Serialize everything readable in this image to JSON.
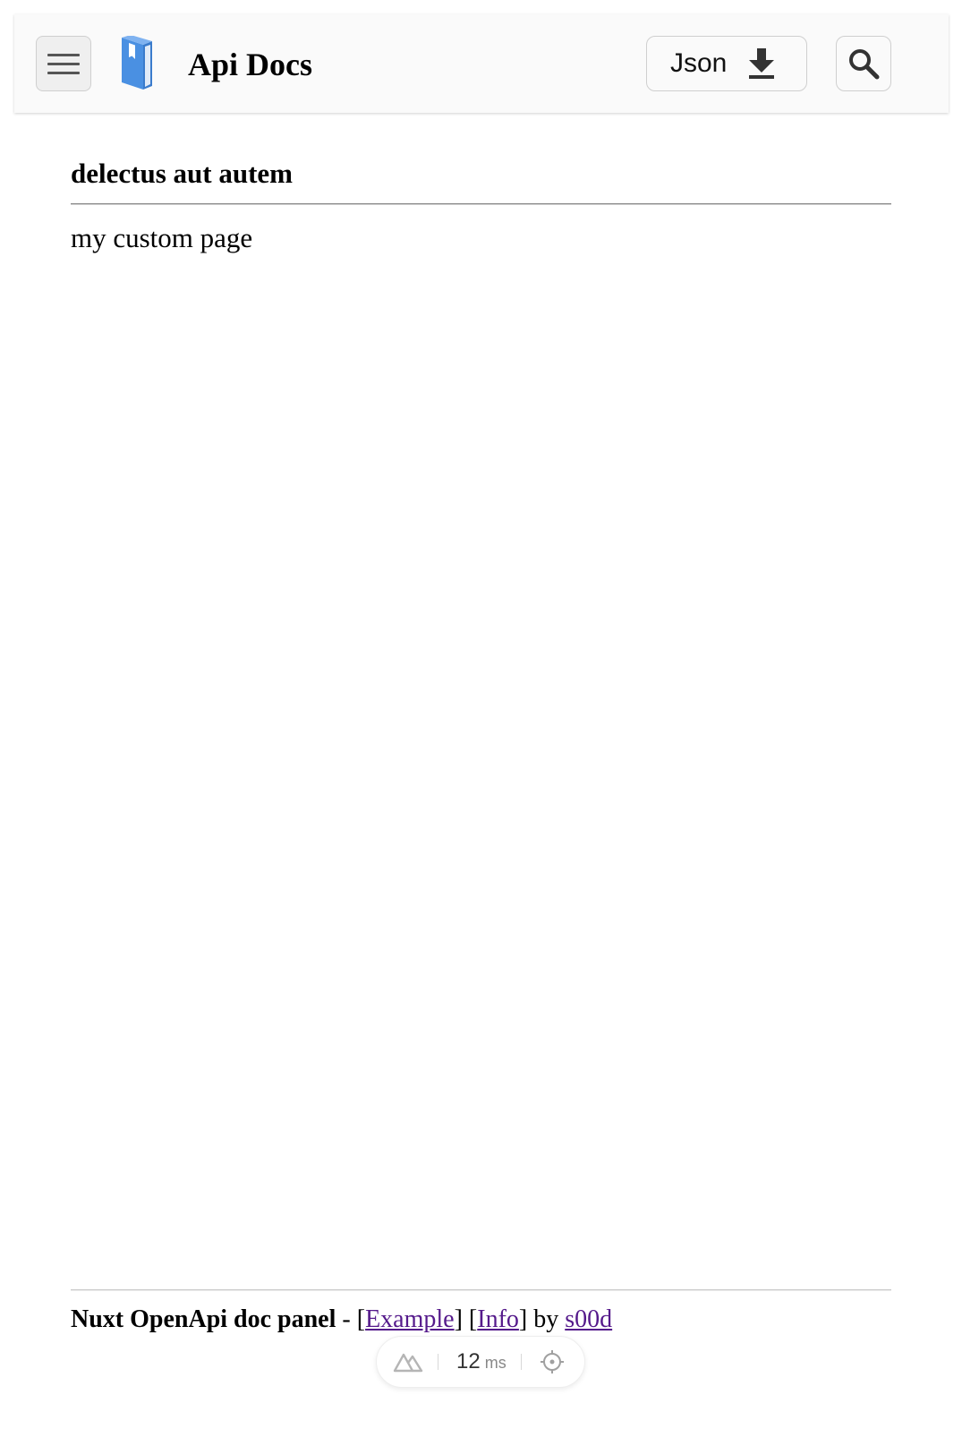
{
  "header": {
    "app_title": "Api Docs",
    "json_button_label": "Json",
    "icons": {
      "menu": "hamburger-menu-icon",
      "logo": "book-icon",
      "download": "download-icon",
      "search": "search-icon"
    },
    "logo_color": "#4a90e2"
  },
  "main": {
    "heading": "delectus aut autem",
    "text": "my custom page"
  },
  "footer": {
    "title": "Nuxt OpenApi doc panel",
    "dash": " - ",
    "bracket_open": "[",
    "bracket_close": "]",
    "example_link": "Example",
    "info_link": "Info",
    "by": " by ",
    "author_link": "s00d",
    "link_color": "#551a8b"
  },
  "dev_badge": {
    "time_value": "12",
    "time_unit": "ms",
    "icons": {
      "nuxt": "nuxt-logo-icon",
      "inspect": "crosshair-icon"
    }
  }
}
